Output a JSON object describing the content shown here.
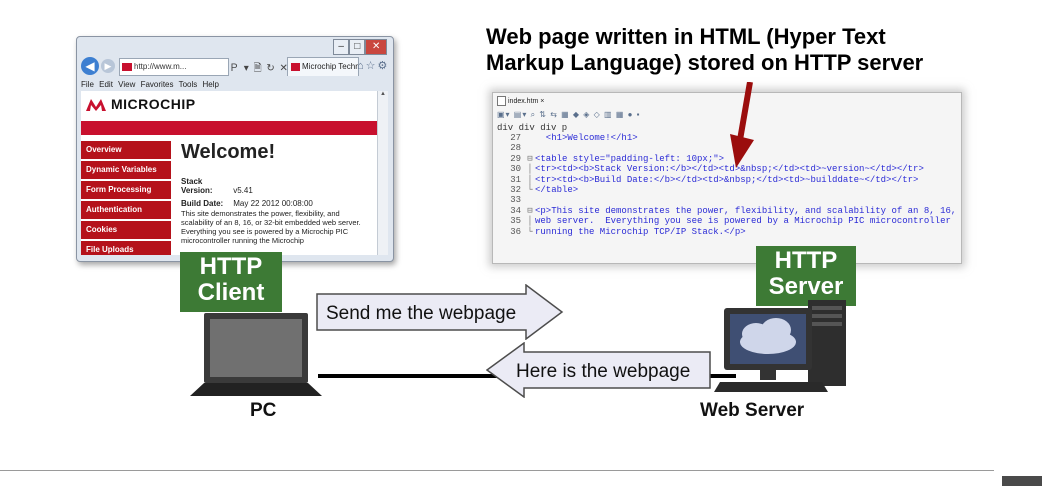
{
  "browser": {
    "address_text": "http://www.m...",
    "nav_controls": "Ｐ ▾ 🗎 ↻ ✕",
    "tab_title": "Microchip Technolo... ×",
    "menu": [
      "File",
      "Edit",
      "View",
      "Favorites",
      "Tools",
      "Help"
    ],
    "logo_text": "MICROCHIP",
    "brand_color": "#c8102e",
    "nav_items": [
      "Overview",
      "Dynamic Variables",
      "Form Processing",
      "Authentication",
      "Cookies",
      "File Uploads"
    ],
    "welcome": "Welcome!",
    "stack_version_label": "Stack Version:",
    "stack_version_value": "v5.41",
    "build_date_label": "Build Date:",
    "build_date_value": "May 22 2012 00:08:00",
    "blurb": "This site demonstrates the power, flexibility, and scalability of an 8, 16, or 32-bit embedded web server. Everything you see is powered by a Microchip PIC microcontroller running the Microchip"
  },
  "labels": {
    "http_client": [
      "HTTP",
      "Client"
    ],
    "http_server": [
      "HTTP",
      "Server"
    ],
    "pc": "PC",
    "web_server": "Web Server",
    "label_color": "#3d7a35"
  },
  "code_title": [
    "Web page written in HTML (Hyper Text",
    "Markup Language) stored on HTTP server"
  ],
  "editor": {
    "tab": "index.htm ×",
    "path": "div div div p",
    "lines": [
      {
        "n": "27",
        "f": "",
        "t": "  <h1>Welcome!</h1>"
      },
      {
        "n": "28",
        "f": "",
        "t": ""
      },
      {
        "n": "29",
        "f": "⊟",
        "t": "<table style=\"padding-left: 10px;\">"
      },
      {
        "n": "30",
        "f": "│",
        "t": "<tr><td><b>Stack Version:</b></td><td>&nbsp;</td><td>~version~</td></tr>"
      },
      {
        "n": "31",
        "f": "│",
        "t": "<tr><td><b>Build Date:</b></td><td>&nbsp;</td><td>~builddate~</td></tr>"
      },
      {
        "n": "32",
        "f": "└",
        "t": "</table>"
      },
      {
        "n": "33",
        "f": "",
        "t": ""
      },
      {
        "n": "34",
        "f": "⊟",
        "t": "<p>This site demonstrates the power, flexibility, and scalability of an 8, 16,"
      },
      {
        "n": "35",
        "f": "│",
        "t": "web server.  Everything you see is powered by a Microchip PIC microcontroller"
      },
      {
        "n": "36",
        "f": "└",
        "t": "running the Microchip TCP/IP Stack.</p>"
      }
    ]
  },
  "messages": {
    "request": "Send me the webpage",
    "response": "Here is the webpage",
    "arrow_fill": "#ebebf5"
  },
  "icons": [
    "back-arrow-icon",
    "forward-arrow-icon",
    "refresh-icon",
    "home-icon",
    "star-icon",
    "gear-icon",
    "laptop-icon",
    "server-icon",
    "cloud-icon",
    "down-arrow-icon"
  ]
}
